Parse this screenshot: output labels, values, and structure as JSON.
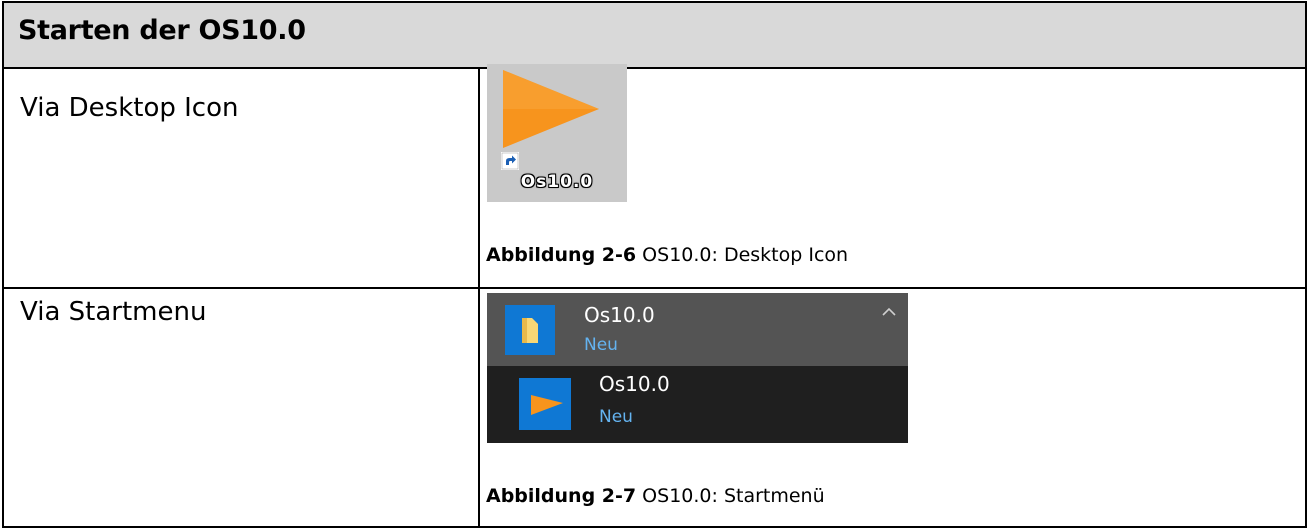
{
  "table": {
    "title": "Starten der OS10.0",
    "rows": [
      {
        "label": "Via Desktop Icon",
        "icon_label": "Os10.0",
        "caption_bold": "Abbildung 2-6",
        "caption_text": " OS10.0: Desktop Icon"
      },
      {
        "label": "Via Startmenu",
        "caption_bold": "Abbildung 2-7",
        "caption_text": " OS10.0: Startmenü"
      }
    ]
  },
  "startmenu": {
    "folder": {
      "name": "Os10.0",
      "badge": "Neu"
    },
    "app": {
      "name": "Os10.0",
      "badge": "Neu"
    }
  },
  "colors": {
    "header_bg": "#d9d9d9",
    "icon_orange": "#f7941d",
    "tile_blue": "#0f78d4",
    "badge_blue": "#64b3f0",
    "menu_dark": "#1f1f1f",
    "menu_selected": "#545454"
  },
  "icons": [
    "orange-triangle-app-icon",
    "shortcut-arrow-icon",
    "folder-icon",
    "chevron-up-icon"
  ]
}
